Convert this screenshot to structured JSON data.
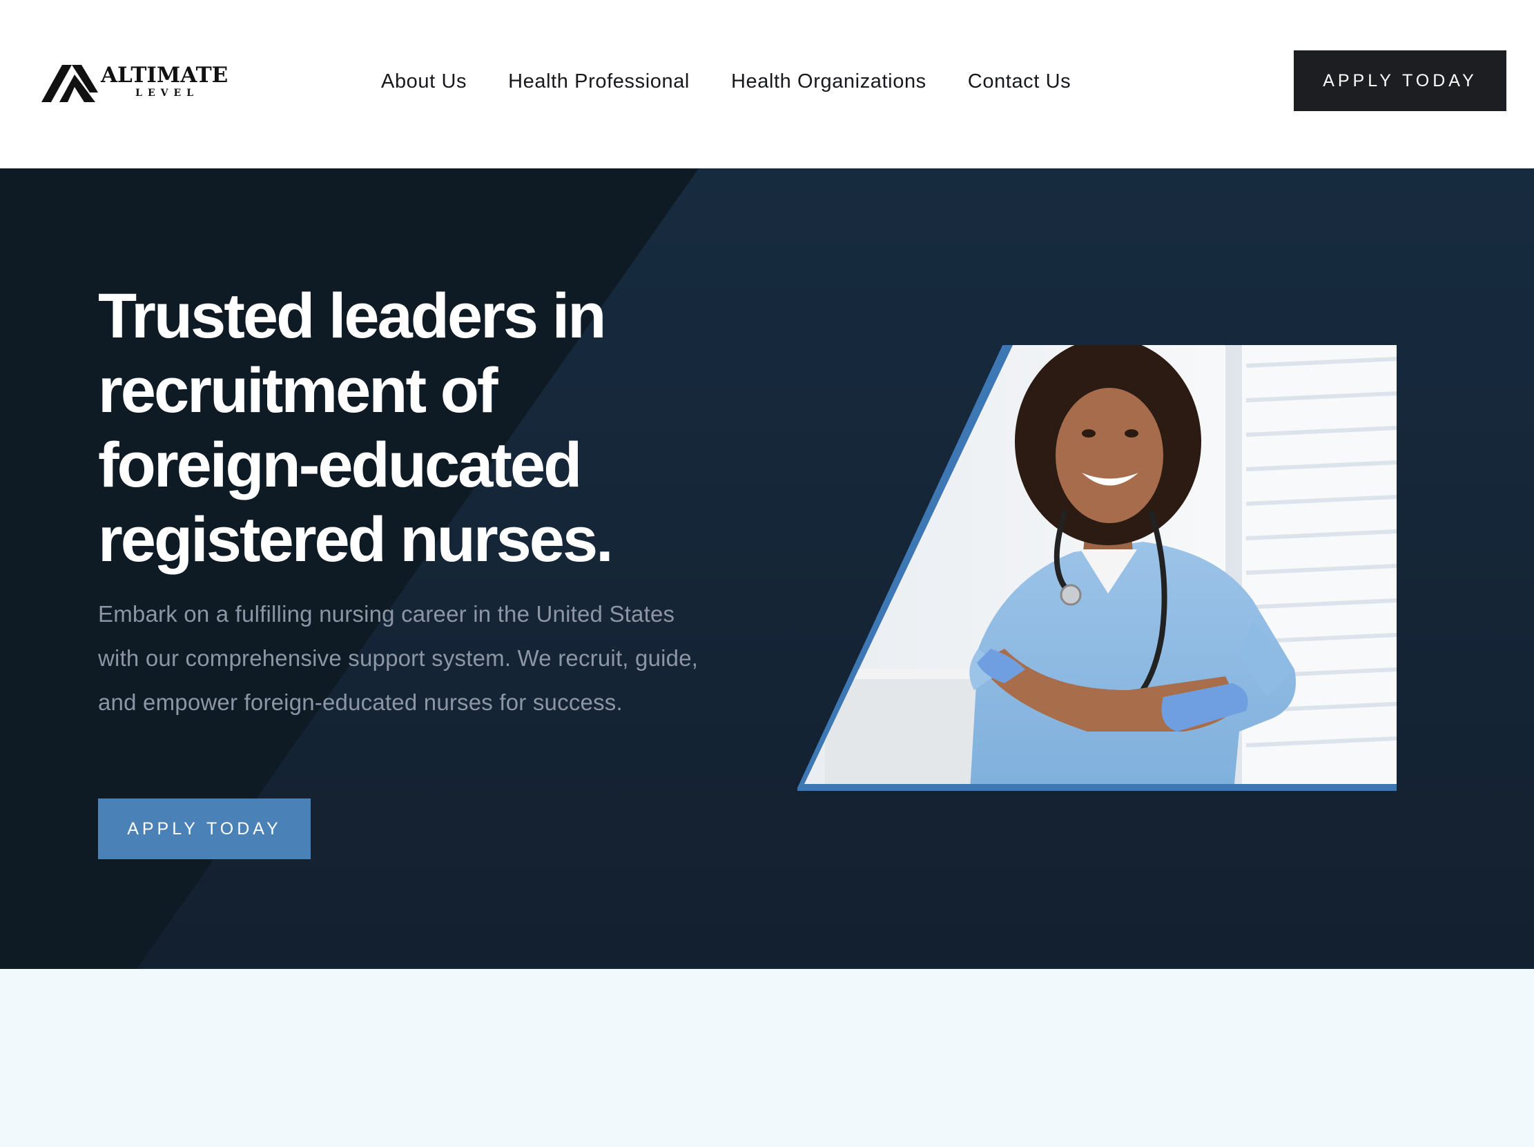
{
  "brand": {
    "name": "ALTIMATE",
    "sub": "LEVEL"
  },
  "nav": {
    "items": [
      {
        "label": "About Us"
      },
      {
        "label": "Health Professional"
      },
      {
        "label": "Health Organizations"
      },
      {
        "label": "Contact Us"
      }
    ]
  },
  "header": {
    "cta_label": "APPLY TODAY"
  },
  "hero": {
    "headline_lines": [
      "Trusted leaders in",
      "recruitment of",
      "foreign-educated",
      "registered nurses."
    ],
    "subtext": "Embark on a fulfilling nursing career in the United States with our comprehensive support system. We recruit, guide, and empower foreign-educated nurses for success.",
    "cta_label": "APPLY TODAY",
    "image_icon": "nurse-photo"
  },
  "colors": {
    "hero_bg": "#14263a",
    "hero_dark": "#0e1a24",
    "accent": "#4a82b8",
    "header_button": "#1c1e22",
    "lower_bg": "#f2f9fc"
  }
}
